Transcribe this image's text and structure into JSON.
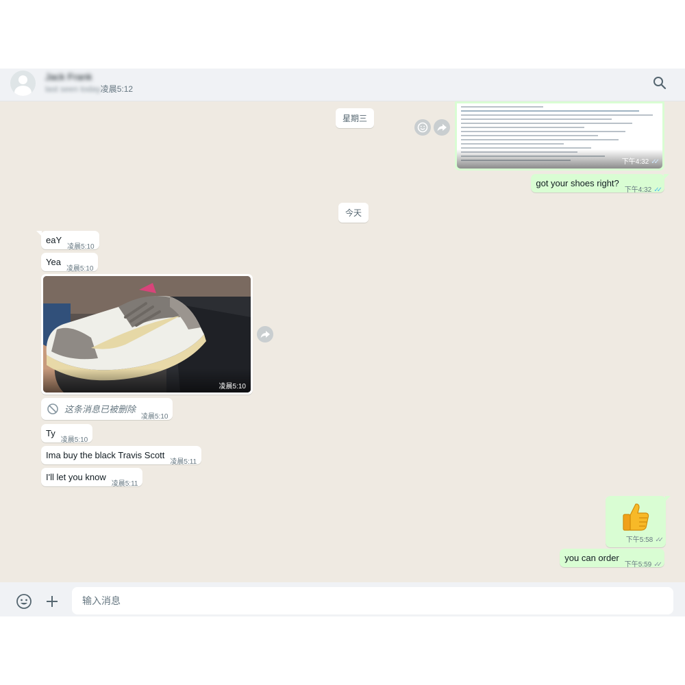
{
  "header": {
    "contact_name": "Jack Frank",
    "status_prefix": "last seen today",
    "status_time": "凌晨5:12",
    "search_icon": "search-icon"
  },
  "dates": {
    "wednesday": "星期三",
    "today": "今天"
  },
  "screenshot_message": {
    "time": "下午4:32"
  },
  "outgoing": [
    {
      "text": "got your shoes right?",
      "time": "下午4:32"
    },
    {
      "emoji": "👍",
      "time": "下午5:58"
    },
    {
      "text": "you can order",
      "time": "下午5:59"
    }
  ],
  "incoming": [
    {
      "text": "eaY",
      "time": "凌晨5:10"
    },
    {
      "text": "Yea",
      "time": "凌晨5:10"
    },
    {
      "photo_time": "凌晨5:10"
    },
    {
      "text": "这条消息已被删除",
      "time": "凌晨5:10"
    },
    {
      "text": "Ty",
      "time": "凌晨5:10"
    },
    {
      "text": "Ima buy the black Travis Scott",
      "time": "凌晨5:11"
    },
    {
      "text": "I'll let you know",
      "time": "凌晨5:11"
    }
  ],
  "composer": {
    "placeholder": "输入消息"
  },
  "colors": {
    "chat_bg": "#efeae2",
    "outgoing_bubble": "#d9fdd3",
    "incoming_bubble": "#ffffff",
    "read_ticks": "#53bdeb",
    "header_bg": "#f0f2f5"
  }
}
